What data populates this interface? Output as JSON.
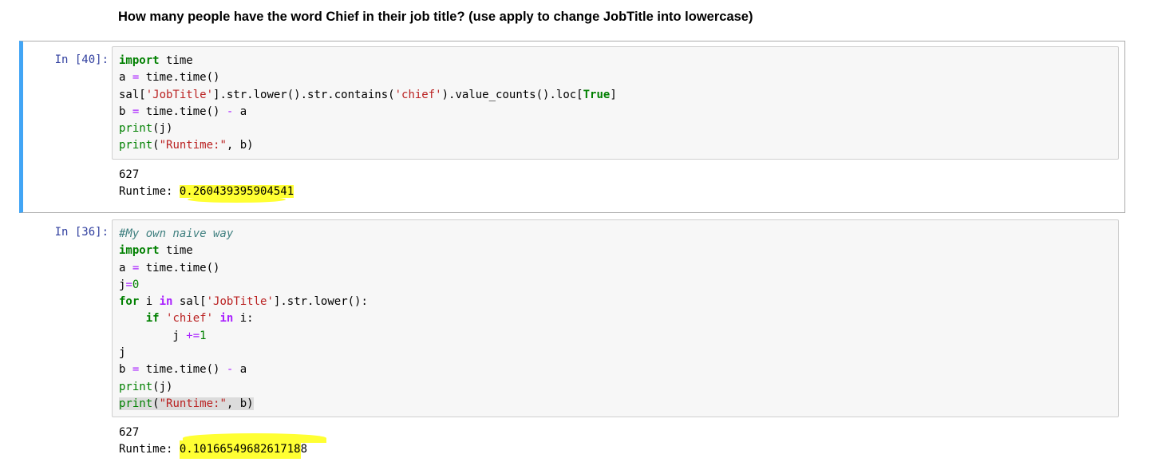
{
  "heading": "How many people have the word Chief in their job title? (use apply to change JobTitle into lowercase)",
  "cells": [
    {
      "prompt": "In [40]:",
      "output_count": "627",
      "output_runtime_label": "Runtime: ",
      "output_runtime_value": "0.260439395904541"
    },
    {
      "prompt": "In [36]:",
      "output_count": "627",
      "output_runtime_label": "Runtime: ",
      "output_runtime_value_highlighted": "0.1016654968261718",
      "output_runtime_value_rest": "8"
    }
  ],
  "colors": {
    "selected_bar": "#42a5f5",
    "prompt": "#303f9f",
    "keyword": "#008000",
    "string": "#ba2121",
    "operator": "#aa22ff",
    "comment": "#408080",
    "highlight": "#ffff33"
  }
}
